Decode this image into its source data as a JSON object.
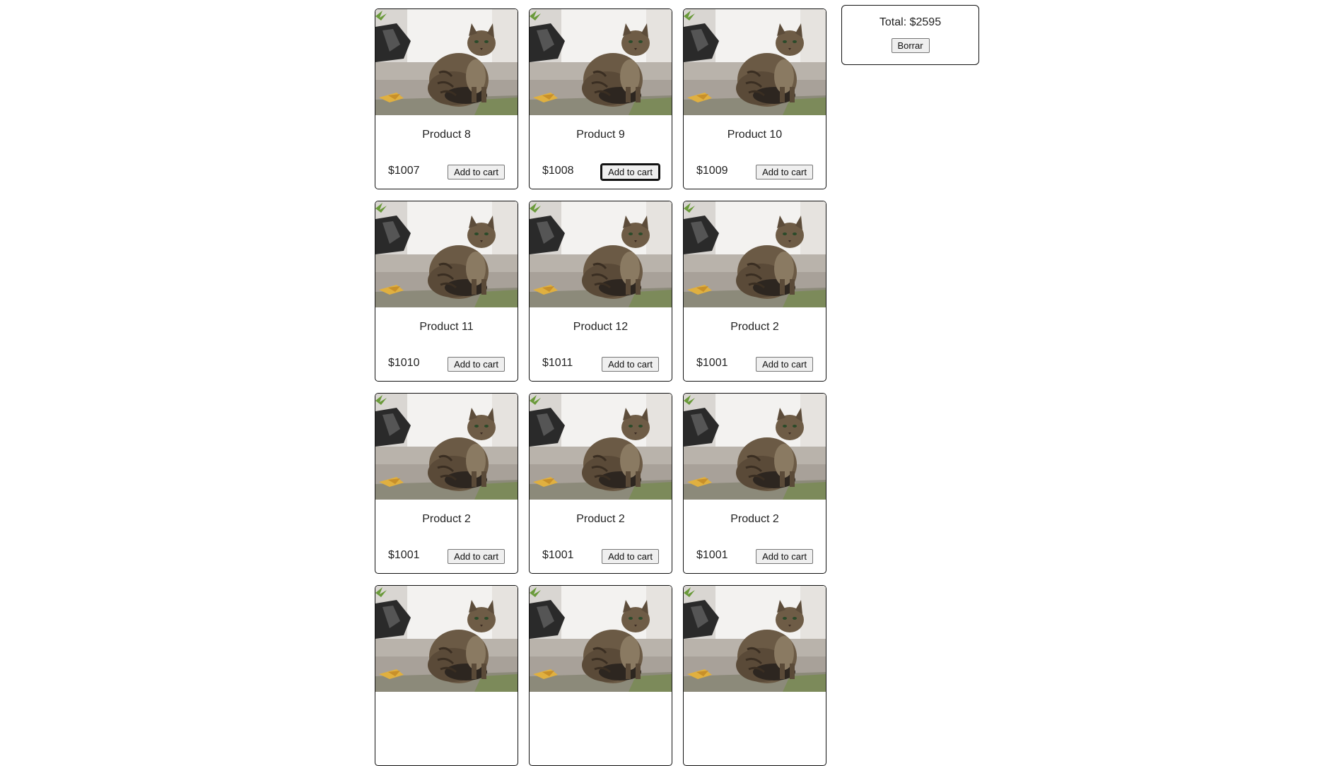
{
  "cart": {
    "total_label": "Total: $2595",
    "clear_label": "Borrar"
  },
  "products": [
    {
      "name": "Product 8",
      "price": "$1007",
      "button": "Add to cart",
      "image": "cat-photo"
    },
    {
      "name": "Product 9",
      "price": "$1008",
      "button": "Add to cart",
      "image": "cat-photo",
      "focused": true
    },
    {
      "name": "Product 10",
      "price": "$1009",
      "button": "Add to cart",
      "image": "cat-photo"
    },
    {
      "name": "Product 11",
      "price": "$1010",
      "button": "Add to cart",
      "image": "cat-photo"
    },
    {
      "name": "Product 12",
      "price": "$1011",
      "button": "Add to cart",
      "image": "cat-photo"
    },
    {
      "name": "Product 2",
      "price": "$1001",
      "button": "Add to cart",
      "image": "cat-photo"
    },
    {
      "name": "Product 2",
      "price": "$1001",
      "button": "Add to cart",
      "image": "cat-photo"
    },
    {
      "name": "Product 2",
      "price": "$1001",
      "button": "Add to cart",
      "image": "cat-photo"
    },
    {
      "name": "Product 2",
      "price": "$1001",
      "button": "Add to cart",
      "image": "cat-photo"
    },
    {
      "name": "",
      "price": "",
      "button": "",
      "image": "cat-photo"
    },
    {
      "name": "",
      "price": "",
      "button": "",
      "image": "cat-photo"
    },
    {
      "name": "",
      "price": "",
      "button": "",
      "image": "cat-photo"
    }
  ]
}
